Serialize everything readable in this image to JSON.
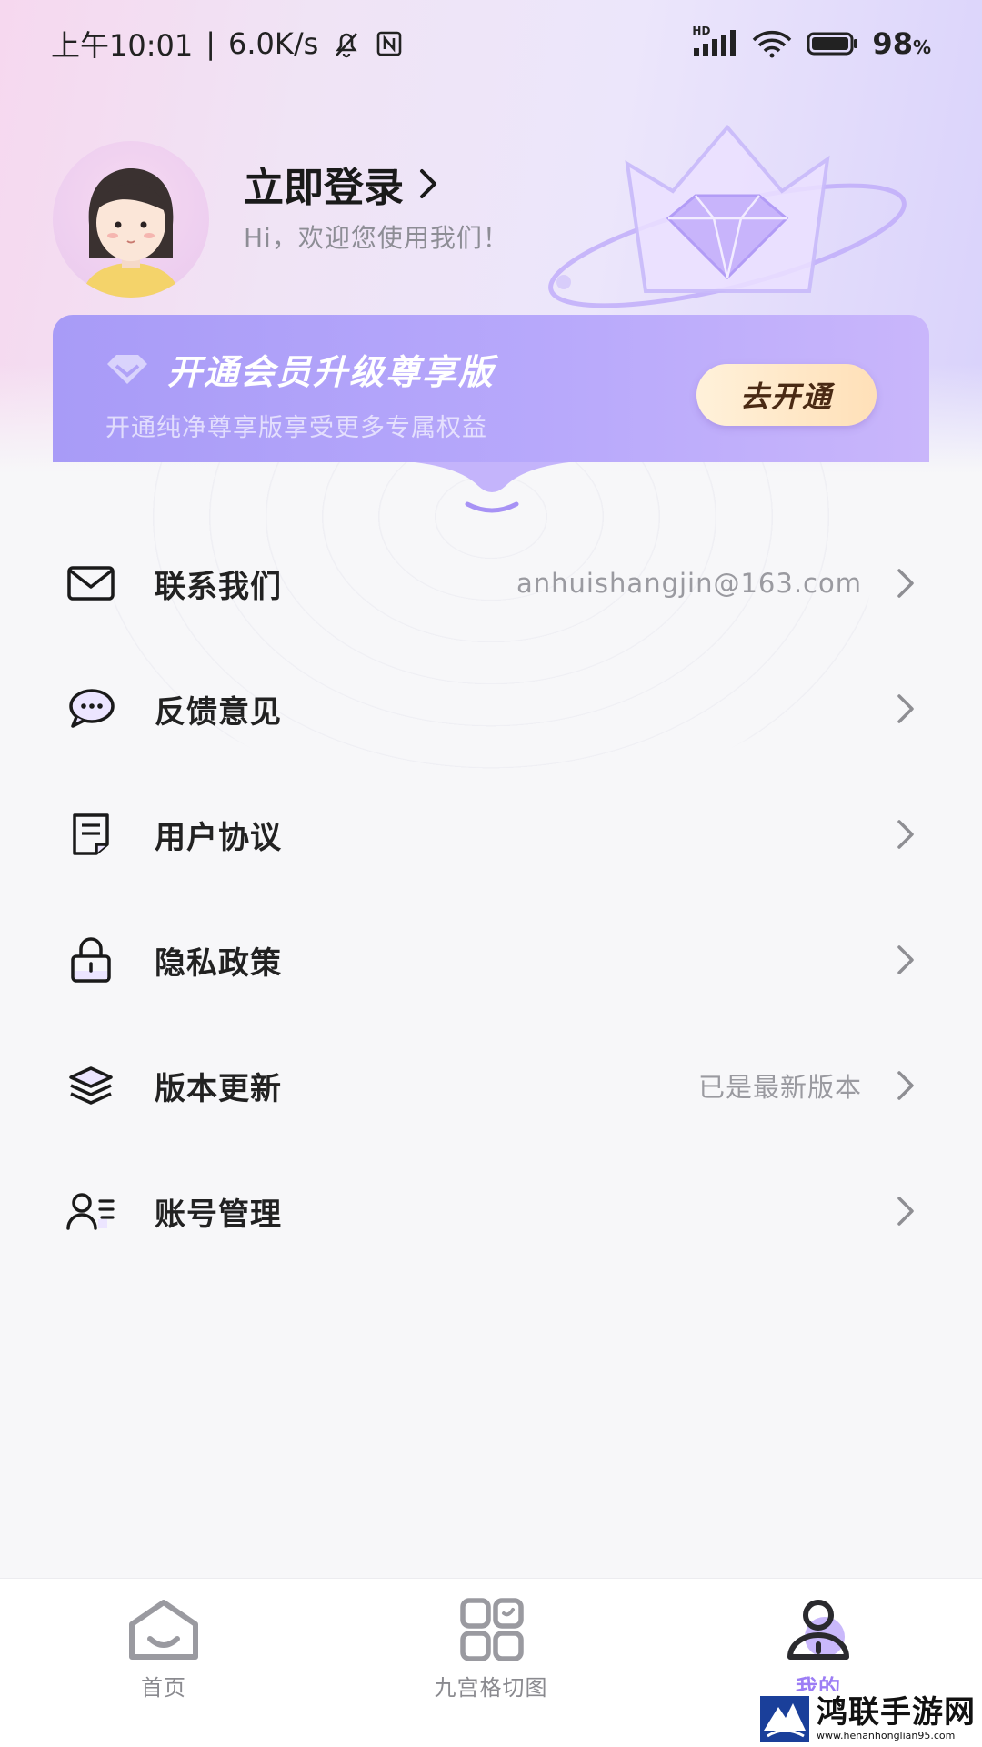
{
  "status_bar": {
    "time": "上午10:01",
    "separator": "|",
    "speed": "6.0K/s",
    "battery_percent": "98",
    "battery_unit": "%",
    "signal_label": "HD",
    "icons": [
      "mute-bell-icon",
      "nfc-icon",
      "signal-icon",
      "wifi-icon",
      "battery-icon"
    ]
  },
  "profile": {
    "login_label": "立即登录",
    "welcome_text": "Hi，欢迎您使用我们！"
  },
  "vip_card": {
    "title": "开通会员升级尊享版",
    "subtitle": "开通纯净尊享版享受更多专属权益",
    "button_label": "去开通"
  },
  "menu": {
    "items": [
      {
        "label": "联系我们",
        "value": "anhuishangjin@163.com",
        "icon": "mail-icon"
      },
      {
        "label": "反馈意见",
        "value": "",
        "icon": "chat-bubble-icon"
      },
      {
        "label": "用户协议",
        "value": "",
        "icon": "document-icon"
      },
      {
        "label": "隐私政策",
        "value": "",
        "icon": "lock-icon"
      },
      {
        "label": "版本更新",
        "value": "已是最新版本",
        "icon": "layers-icon"
      },
      {
        "label": "账号管理",
        "value": "",
        "icon": "user-list-icon"
      }
    ]
  },
  "tab_bar": {
    "tabs": [
      {
        "label": "首页",
        "icon": "home-icon",
        "active": false
      },
      {
        "label": "九宫格切图",
        "icon": "grid-icon",
        "active": false
      },
      {
        "label": "我的",
        "icon": "profile-icon",
        "active": true
      }
    ]
  },
  "watermark": {
    "main": "鸿联手游网",
    "url": "www.henanhonglian95.com"
  },
  "colors": {
    "accent": "#9c7df5",
    "vip_card": "#b2a3fa",
    "vip_button": "#ffe6c4"
  }
}
